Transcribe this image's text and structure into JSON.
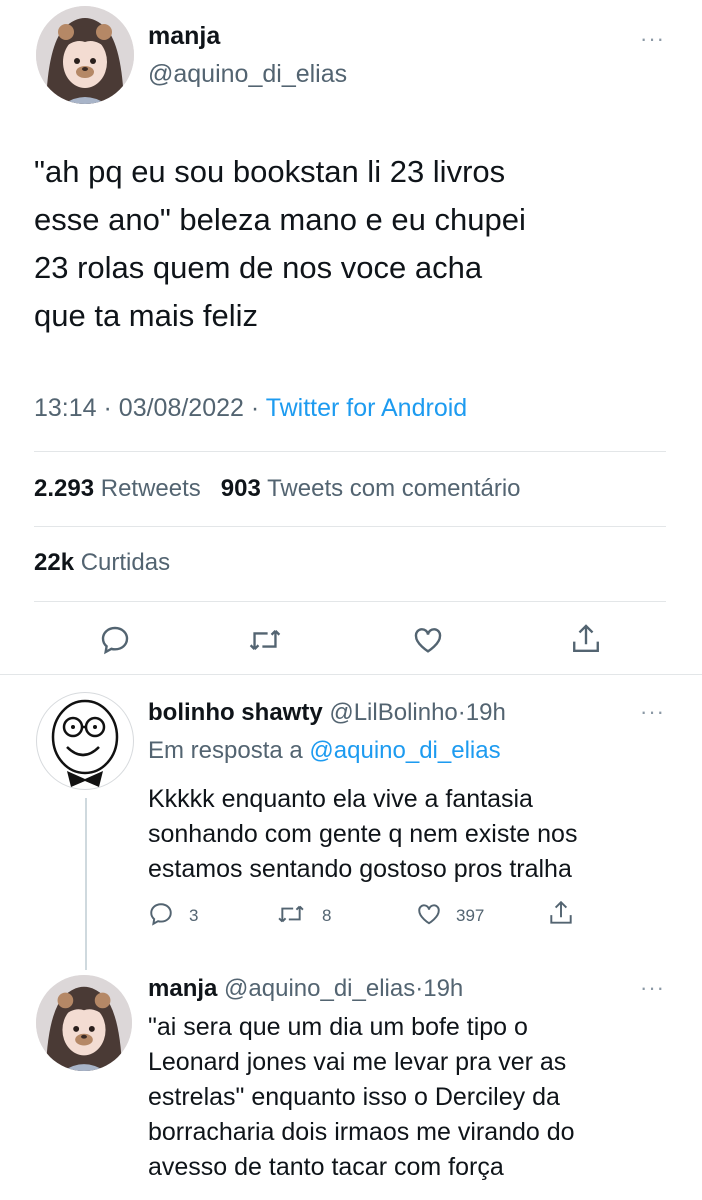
{
  "main_tweet": {
    "name": "manja",
    "handle": "@aquino_di_elias",
    "text": "\"ah pq eu sou bookstan li 23 livros\nesse ano\" beleza mano e eu chupei\n23 rolas quem de nos voce acha\nque ta mais feliz",
    "time": "13:14",
    "sep": "·",
    "date": "03/08/2022",
    "source": "Twitter for Android",
    "retweets_count": "2.293",
    "retweets_label": "Retweets",
    "quotes_count": "903",
    "quotes_label": "Tweets com comentário",
    "likes_count": "22k",
    "likes_label": "Curtidas",
    "more": "···"
  },
  "replies": [
    {
      "name": "bolinho shawty",
      "handle": "@LilBolinho",
      "sep": "·",
      "time": "19h",
      "reply_prefix": "Em resposta a",
      "reply_to": "@aquino_di_elias",
      "text": "Kkkkk enquanto ela vive a fantasia\nsonhando com gente q nem existe nos\nestamos sentando gostoso pros tralha",
      "reply_count": "3",
      "retweet_count": "8",
      "like_count": "397",
      "more": "···"
    },
    {
      "name": "manja",
      "handle": "@aquino_di_elias",
      "sep": "·",
      "time": "19h",
      "text": "\"ai sera que um dia um bofe tipo o\nLeonard jones vai me levar pra ver as\nestrelas\" enquanto isso o Derciley da\nborracharia dois irmaos me virando do\navesso de tanto tacar com força",
      "more": "···"
    }
  ],
  "colors": {
    "text": "#0f1419",
    "muted": "#536471",
    "link": "#1d9bf0",
    "divider": "#e3e6e8"
  },
  "icons": [
    "reply-icon",
    "retweet-icon",
    "like-icon",
    "share-icon",
    "more-icon"
  ]
}
